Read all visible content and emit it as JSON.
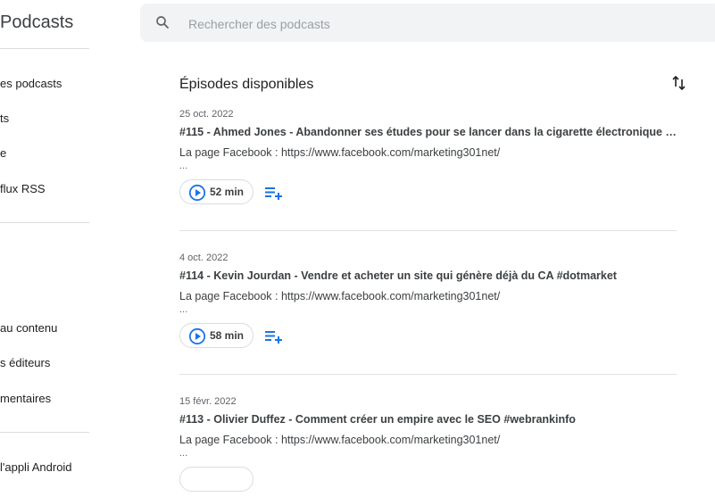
{
  "app": {
    "title": "Podcasts"
  },
  "sidebar": {
    "items": [
      {
        "label": "es podcasts"
      },
      {
        "label": "ts"
      },
      {
        "label": "e"
      },
      {
        "label": "flux RSS"
      },
      {
        "label": "au contenu"
      },
      {
        "label": "s éditeurs"
      },
      {
        "label": "mentaires"
      },
      {
        "label": "l'appli Android"
      }
    ]
  },
  "search": {
    "placeholder": "Rechercher des podcasts",
    "value": ""
  },
  "main": {
    "section_title": "Épisodes disponibles",
    "episodes": [
      {
        "date": "25 oct. 2022",
        "title": "#115 - Ahmed Jones - Abandonner ses études pour se lancer dans la cigarette électronique #...",
        "description": "La page Facebook : https://www.facebook.com/marketing301net/",
        "more": "...",
        "duration": "52 min"
      },
      {
        "date": "4 oct. 2022",
        "title": "#114 - Kevin Jourdan - Vendre et acheter un site qui génère déjà du CA #dotmarket",
        "description": "La page Facebook : https://www.facebook.com/marketing301net/",
        "more": "...",
        "duration": "58 min"
      },
      {
        "date": "15 févr. 2022",
        "title": "#113 - Olivier Duffez - Comment créer un empire avec le SEO #webrankinfo",
        "description": "La page Facebook : https://www.facebook.com/marketing301net/",
        "more": "..."
      }
    ]
  },
  "colors": {
    "accent": "#1a73e8",
    "search_bg": "#f1f3f4",
    "divider": "#dadce0"
  }
}
